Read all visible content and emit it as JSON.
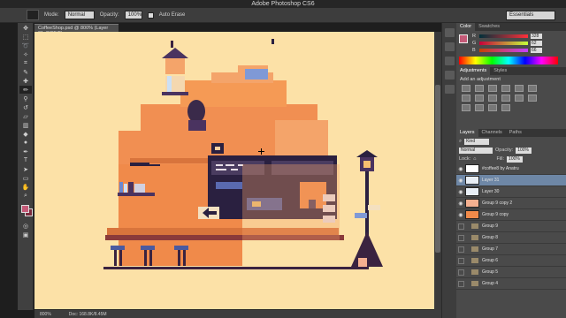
{
  "app_title": "Adobe Photoshop CS6",
  "options_bar": {
    "mode_label": "Mode:",
    "mode_value": "Normal",
    "opacity_label": "Opacity:",
    "opacity_value": "100%",
    "auto_erase_label": "Auto Erase",
    "workspace_value": "Essentials"
  },
  "document": {
    "tab_label": "CoffeeShop.psd @ 800% (Layer 31, RGB/8)",
    "canvas_color": "#fce1a7"
  },
  "status_bar": {
    "zoom": "800%",
    "doc_size": "Doc: 168.8K/8.45M"
  },
  "panels": {
    "color": {
      "tab_active": "Color",
      "tab_other": "Swatches",
      "channels": [
        {
          "name": "R",
          "value": "328"
        },
        {
          "name": "G",
          "value": "62"
        },
        {
          "name": "B",
          "value": "66"
        }
      ]
    },
    "adjustments": {
      "tab_active": "Adjustments",
      "tab_other": "Styles",
      "hint": "Add an adjustment"
    },
    "layers": {
      "tab_active": "Layers",
      "tab_channels": "Channels",
      "tab_paths": "Paths",
      "kind_label": "Kind",
      "blend_value": "Normal",
      "opacity_label": "Opacity:",
      "opacity_value": "100%",
      "lock_label": "Lock:",
      "fill_label": "Fill:",
      "fill_value": "100%",
      "rows": [
        {
          "name": "#coffee8 by Anatru",
          "kind": "text"
        },
        {
          "name": "Layer 31",
          "kind": "layer",
          "selected": true
        },
        {
          "name": "Layer 30",
          "kind": "layer"
        },
        {
          "name": "Group 9 copy 2",
          "kind": "layer"
        },
        {
          "name": "Group 9 copy",
          "kind": "layer"
        },
        {
          "name": "Group 9",
          "kind": "group"
        },
        {
          "name": "Group 8",
          "kind": "group"
        },
        {
          "name": "Group 7",
          "kind": "group"
        },
        {
          "name": "Group 6",
          "kind": "group"
        },
        {
          "name": "Group 5",
          "kind": "group"
        },
        {
          "name": "Group 4",
          "kind": "group"
        }
      ]
    }
  },
  "colors": {
    "foreground": "#c55a78",
    "background": "#7a2a3c",
    "selection": "#6e87a6"
  }
}
